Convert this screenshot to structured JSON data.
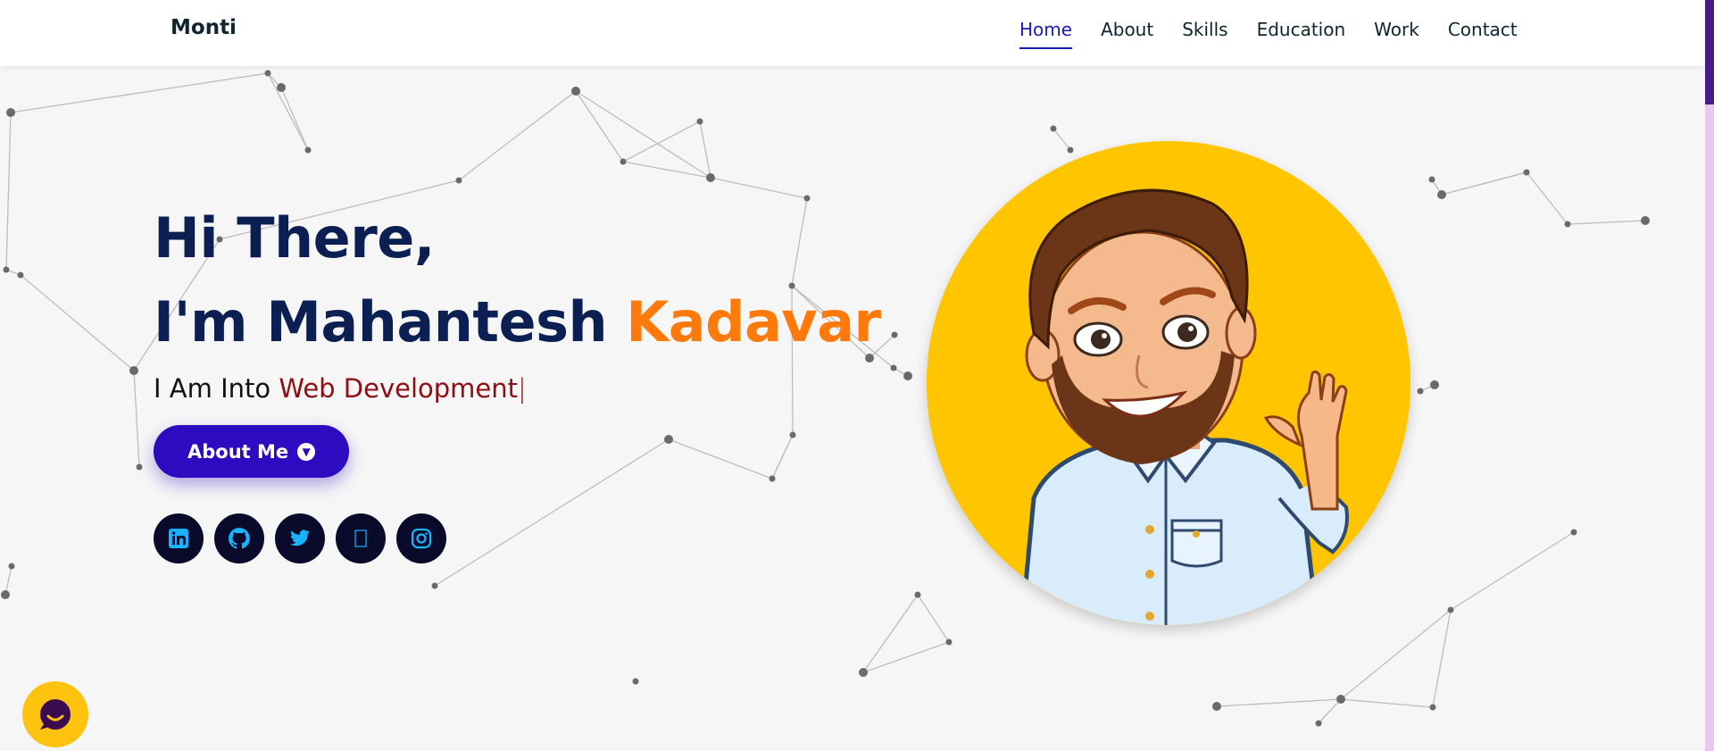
{
  "navbar": {
    "brand": "Monti",
    "links": [
      {
        "label": "Home",
        "active": true
      },
      {
        "label": "About"
      },
      {
        "label": "Skills"
      },
      {
        "label": "Education"
      },
      {
        "label": "Work"
      },
      {
        "label": "Contact"
      }
    ]
  },
  "hero": {
    "greeting": "Hi There,",
    "name_prefix": "I'm Mahantesh ",
    "name_accent": "Kadavar",
    "typed_prefix": "I Am Into ",
    "typed_word": "Web Development",
    "typed_cursor": "|",
    "button_label": "About Me",
    "button_icon": "chevron-down-circle-icon"
  },
  "socials": [
    {
      "name": "linkedin",
      "icon": "linkedin-icon"
    },
    {
      "name": "github",
      "icon": "github-icon"
    },
    {
      "name": "twitter",
      "icon": "twitter-icon"
    },
    {
      "name": "dev",
      "icon": "dev-icon"
    },
    {
      "name": "instagram",
      "icon": "instagram-icon"
    }
  ],
  "avatar": {
    "description_icon": "bitmoji-avatar",
    "background": "#ffc600"
  },
  "colors": {
    "primary": "#0b1f52",
    "accent": "#ff7a0b",
    "typed": "#8f0d12",
    "button": "#2c0bc0",
    "icon": "#1ab3ff",
    "social_bg": "#0a0a2a",
    "scrollbar_thumb": "#4b1a8a",
    "scrollbar_track": "#e9c8f0"
  },
  "chat": {
    "icon": "chat-bubble-icon"
  }
}
